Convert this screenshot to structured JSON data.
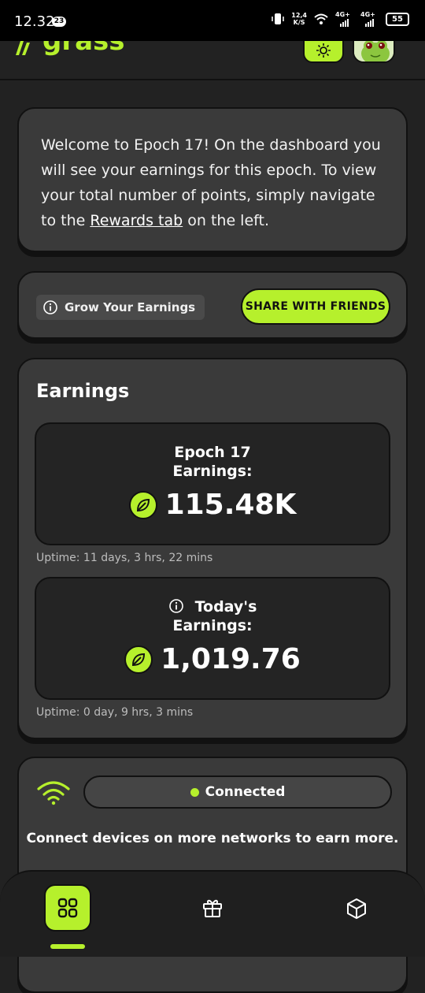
{
  "status_bar": {
    "time": "12.32",
    "notification_count": "23",
    "net_speed_value": "12,4",
    "net_speed_unit": "K/S",
    "sim1": "4G+",
    "sim2": "4G+",
    "battery": "55"
  },
  "header": {
    "logo_text": "grass"
  },
  "welcome": {
    "text_before": "Welcome to Epoch 17! On the dashboard you will see your earnings for this epoch. To view your total number of points, simply navigate to the ",
    "link_text": "Rewards tab",
    "text_after": " on the left."
  },
  "grow": {
    "pill_label": "Grow Your Earnings",
    "share_button": "SHARE WITH FRIENDS"
  },
  "earnings": {
    "title": "Earnings",
    "epoch_label_line1": "Epoch 17",
    "epoch_label_line2": "Earnings:",
    "epoch_value": "115.48K",
    "epoch_uptime": "Uptime: 11 days, 3 hrs, 22 mins",
    "today_label_line1": "Today's",
    "today_label_line2": "Earnings:",
    "today_value": "1,019.76",
    "today_uptime": "Uptime: 0 day, 9 hrs, 3 mins"
  },
  "connection": {
    "status": "Connected",
    "message": "Connect devices on more networks to earn more."
  },
  "colors": {
    "accent": "#b6f02c",
    "background": "#222222",
    "card": "#3a3a3a"
  },
  "icons": [
    "info-icon",
    "leaf-coin-icon",
    "wifi-icon",
    "dashboard-grid-icon",
    "gift-icon",
    "cube-icon",
    "sun-icon"
  ]
}
